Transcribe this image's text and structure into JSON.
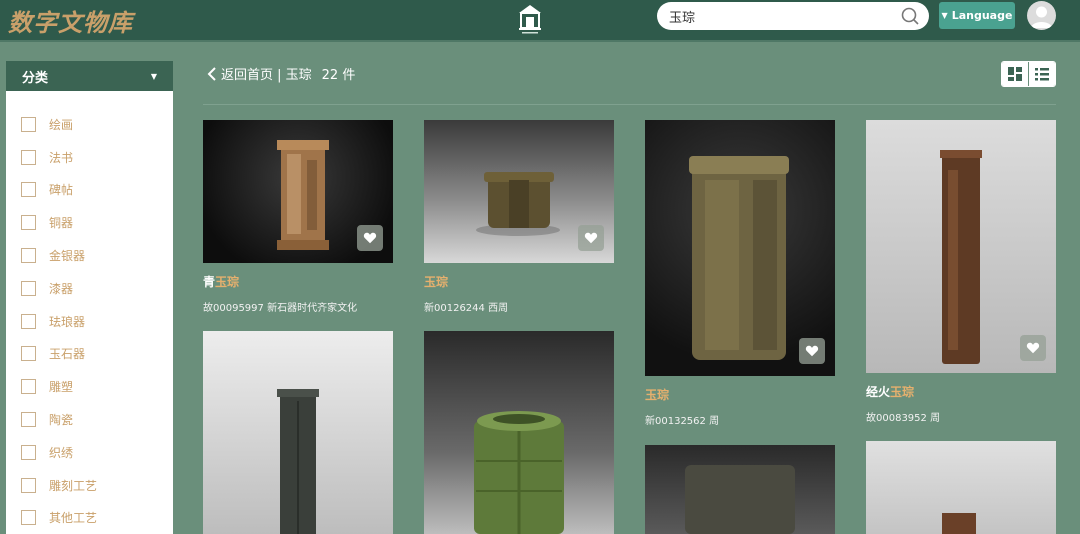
{
  "header": {
    "brand": "数字文物库",
    "search_value": "玉琮",
    "language_label": "Language"
  },
  "sidebar": {
    "title": "分类",
    "items": [
      {
        "label": "绘画"
      },
      {
        "label": "法书"
      },
      {
        "label": "碑帖"
      },
      {
        "label": "铜器"
      },
      {
        "label": "金银器"
      },
      {
        "label": "漆器"
      },
      {
        "label": "珐琅器"
      },
      {
        "label": "玉石器"
      },
      {
        "label": "雕塑"
      },
      {
        "label": "陶瓷"
      },
      {
        "label": "织绣"
      },
      {
        "label": "雕刻工艺"
      },
      {
        "label": "其他工艺"
      }
    ]
  },
  "main": {
    "breadcrumb": "返回首页 | 玉琮",
    "count": "22 件"
  },
  "cards": [
    {
      "prefix": "青",
      "highlight": "玉琮",
      "id": "故00095997",
      "period": "新石器时代齐家文化"
    },
    {
      "prefix": "",
      "highlight": "玉琮",
      "id": "新00126244",
      "period": "西周"
    },
    {
      "prefix": "",
      "highlight": "玉琮",
      "id": "新00132562",
      "period": "周"
    },
    {
      "prefix": "经火",
      "highlight": "玉琮",
      "id": "故00083952",
      "period": "周"
    }
  ],
  "colors": {
    "background": "#6a8f7b",
    "header": "#2f5a4b",
    "accent": "#4aa290",
    "highlight": "#e6b06e"
  },
  "icons": [
    "search-icon",
    "avatar-icon",
    "chevron-left-icon",
    "grid-view-icon",
    "list-view-icon",
    "heart-icon"
  ]
}
